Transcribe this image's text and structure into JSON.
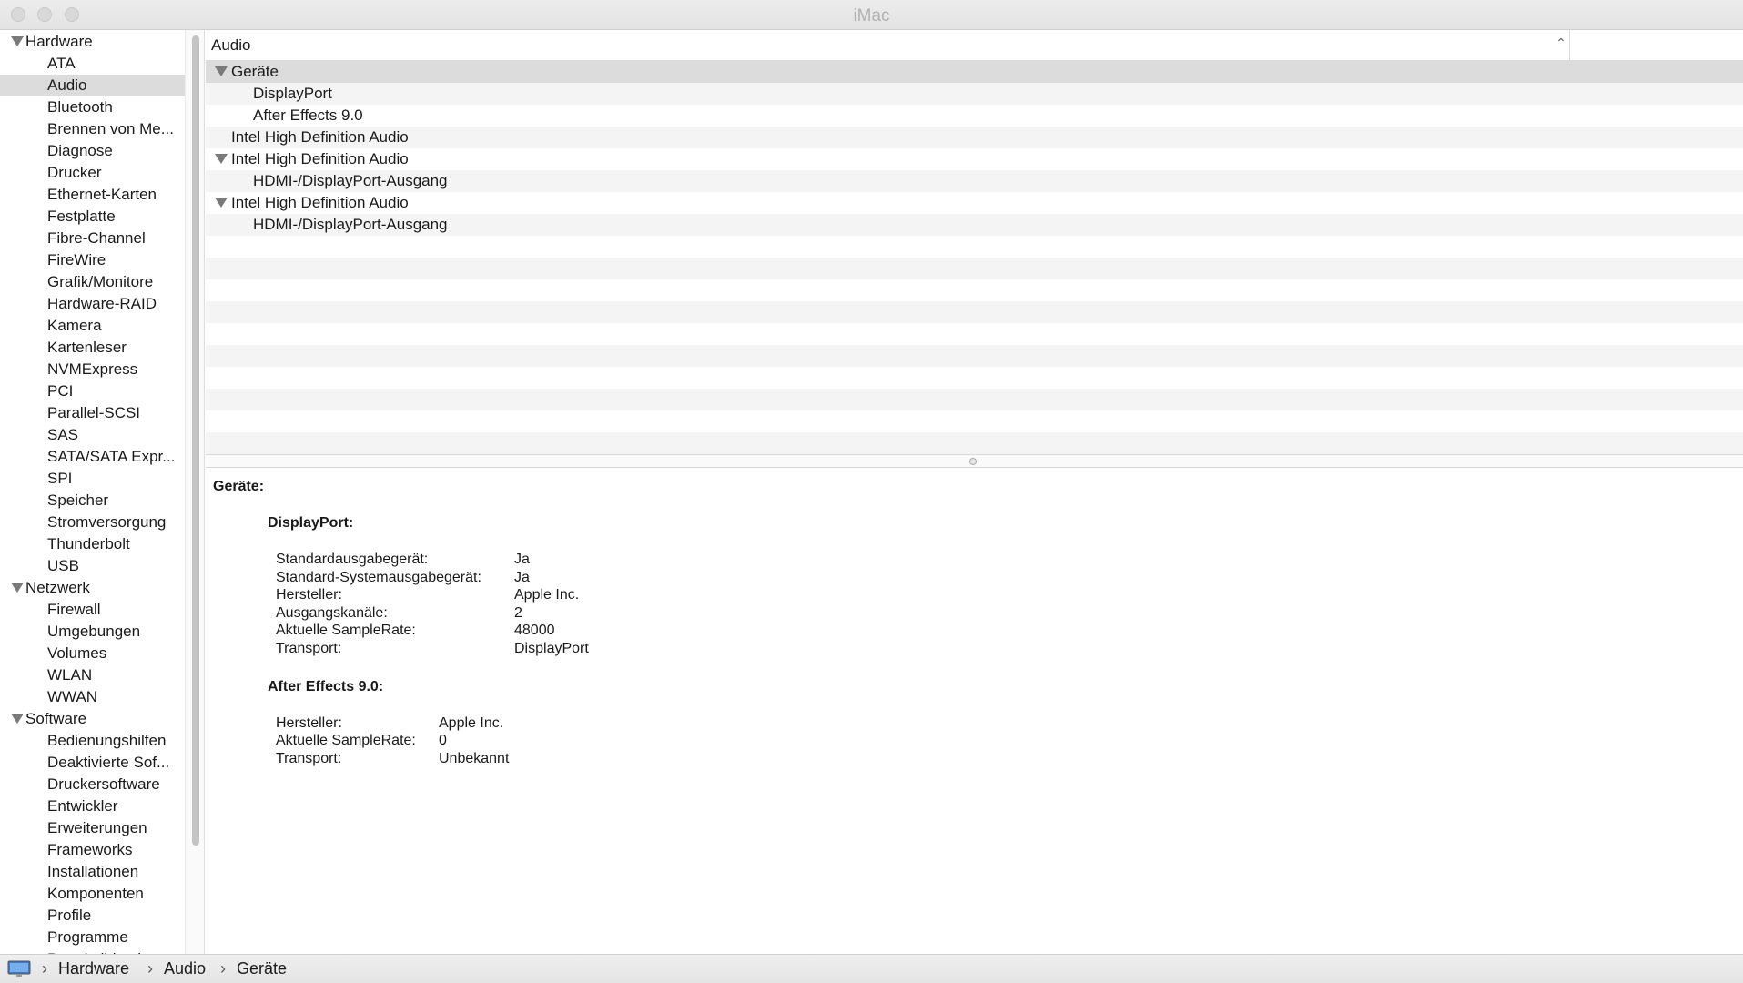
{
  "window": {
    "title": "iMac"
  },
  "sidebar": {
    "groups": [
      {
        "label": "Hardware",
        "items": [
          "ATA",
          "Audio",
          "Bluetooth",
          "Brennen von Me...",
          "Diagnose",
          "Drucker",
          "Ethernet-Karten",
          "Festplatte",
          "Fibre-Channel",
          "FireWire",
          "Grafik/Monitore",
          "Hardware-RAID",
          "Kamera",
          "Kartenleser",
          "NVMExpress",
          "PCI",
          "Parallel-SCSI",
          "SAS",
          "SATA/SATA Expr...",
          "SPI",
          "Speicher",
          "Stromversorgung",
          "Thunderbolt",
          "USB"
        ]
      },
      {
        "label": "Netzwerk",
        "items": [
          "Firewall",
          "Umgebungen",
          "Volumes",
          "WLAN",
          "WWAN"
        ]
      },
      {
        "label": "Software",
        "items": [
          "Bedienungshilfen",
          "Deaktivierte Sof...",
          "Druckersoftware",
          "Entwickler",
          "Erweiterungen",
          "Frameworks",
          "Installationen",
          "Komponenten",
          "Profile",
          "Programme",
          "Protokolldateien"
        ]
      }
    ],
    "selected": "Audio"
  },
  "tree": {
    "column_header": "Audio",
    "rows": [
      {
        "label": "Geräte",
        "level": 0,
        "expanded": true,
        "selected": true
      },
      {
        "label": "DisplayPort",
        "level": 1
      },
      {
        "label": "After Effects 9.0",
        "level": 1
      },
      {
        "label": "Intel High Definition Audio",
        "level": 0
      },
      {
        "label": "Intel High Definition Audio",
        "level": 0,
        "expanded": true
      },
      {
        "label": "HDMI-/DisplayPort-Ausgang",
        "level": 1
      },
      {
        "label": "Intel High Definition Audio",
        "level": 0,
        "expanded": true
      },
      {
        "label": "HDMI-/DisplayPort-Ausgang",
        "level": 1
      }
    ]
  },
  "detail": {
    "heading": "Geräte:",
    "sections": [
      {
        "title": "DisplayPort:",
        "props": [
          {
            "k": "Standardausgabegerät:",
            "v": "Ja"
          },
          {
            "k": "Standard-Systemausgabegerät:",
            "v": "Ja"
          },
          {
            "k": "Hersteller:",
            "v": "Apple Inc."
          },
          {
            "k": "Ausgangskanäle:",
            "v": "2"
          },
          {
            "k": "Aktuelle SampleRate:",
            "v": "48000"
          },
          {
            "k": "Transport:",
            "v": "DisplayPort"
          }
        ]
      },
      {
        "title": "After Effects 9.0:",
        "props": [
          {
            "k": "Hersteller:",
            "v": "Apple Inc."
          },
          {
            "k": "Aktuelle SampleRate:",
            "v": "0"
          },
          {
            "k": "Transport:",
            "v": "Unbekannt"
          }
        ]
      }
    ]
  },
  "pathbar": {
    "crumbs": [
      "Hardware",
      "Audio",
      "Geräte"
    ]
  },
  "colors": {
    "selection": "#dcdcdc",
    "stripe": "#f4f4f4"
  }
}
